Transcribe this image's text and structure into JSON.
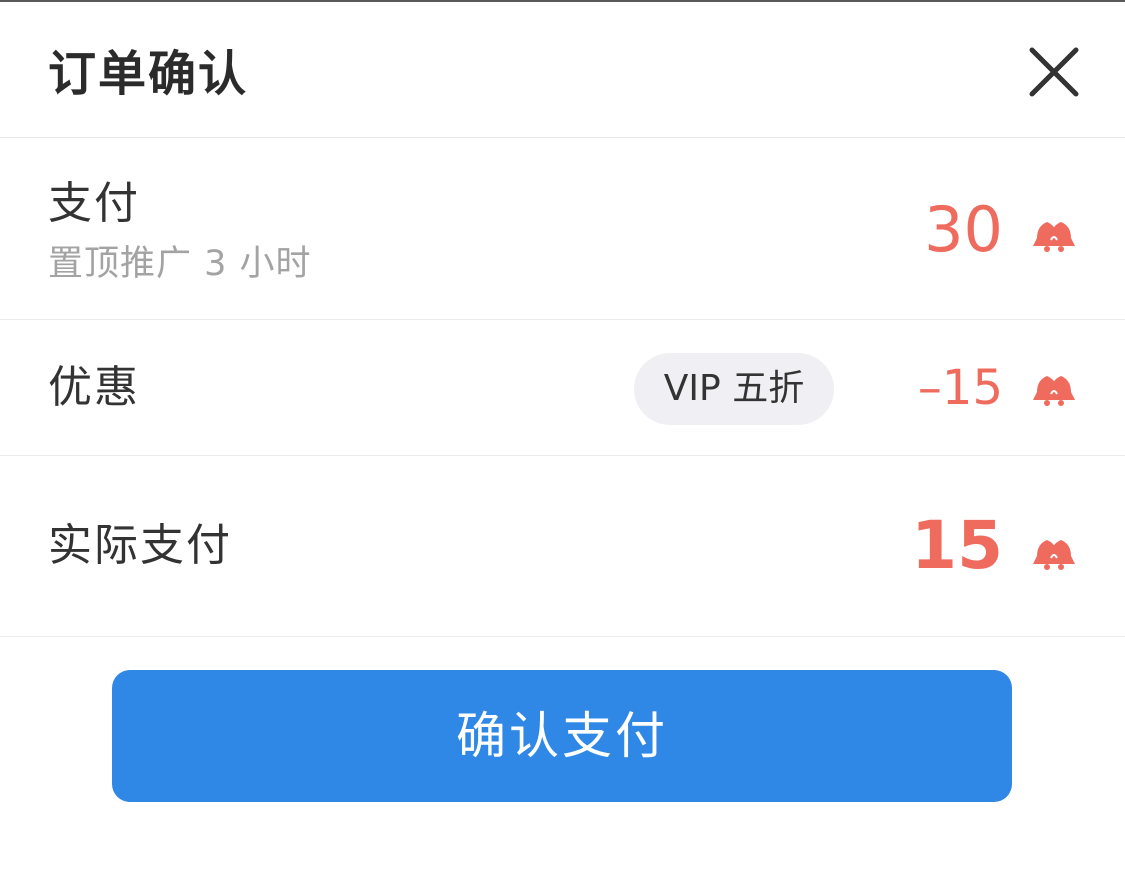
{
  "header": {
    "title": "订单确认",
    "close_icon": "close-icon"
  },
  "pay_row": {
    "label": "支付",
    "description": "置顶推广 3 小时",
    "amount": "30",
    "currency_icon": "bell-coin-icon"
  },
  "discount_row": {
    "label": "优惠",
    "badge": "VIP 五折",
    "amount": "–15",
    "currency_icon": "bell-coin-icon"
  },
  "actual_row": {
    "label": "实际支付",
    "amount": "15",
    "currency_icon": "bell-coin-icon"
  },
  "confirm_button": {
    "label": "确认支付"
  },
  "colors": {
    "price": "#ef6b5e",
    "primary_button": "#2f88e6",
    "badge_bg": "#efeff4"
  }
}
